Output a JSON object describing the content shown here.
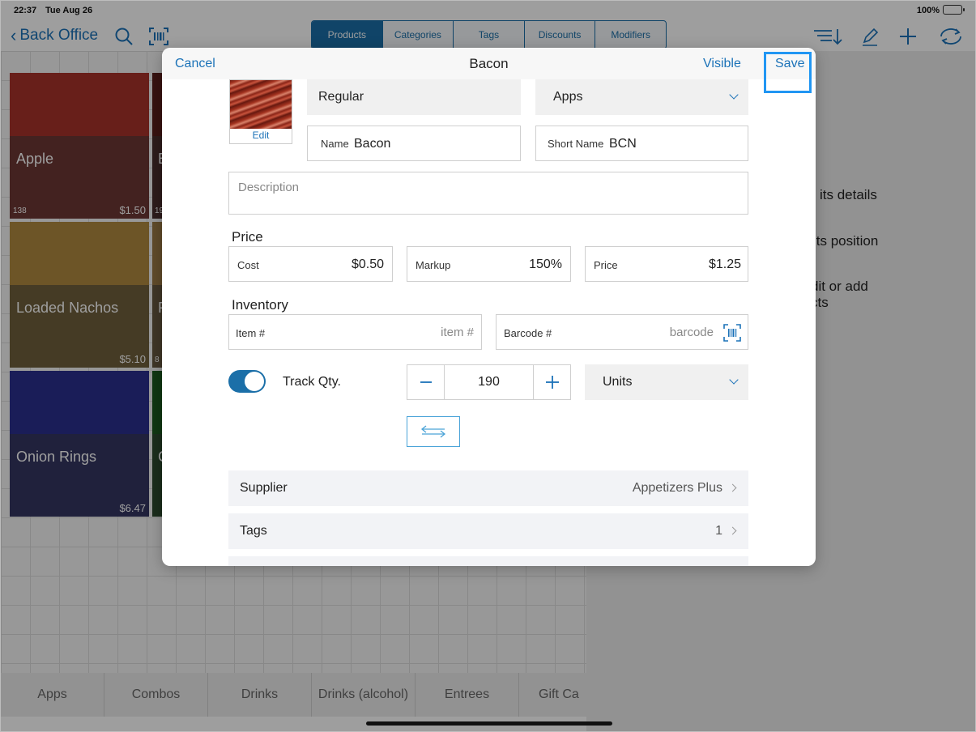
{
  "status_bar": {
    "time": "22:37",
    "date": "Tue Aug 26",
    "battery": "100%"
  },
  "nav": {
    "back_label": "Back Office",
    "tabs": [
      "Products",
      "Categories",
      "Tags",
      "Discounts",
      "Modifiers"
    ],
    "active_tab": "Products"
  },
  "tiles": [
    {
      "name": "Apple",
      "price": "$1.50",
      "count": "138",
      "color": "#a8322a"
    },
    {
      "name": "Loaded Nachos",
      "price": "$5.10",
      "count": "",
      "color": "#b0893f"
    },
    {
      "name": "Onion Rings",
      "price": "$6.47",
      "count": "",
      "color": "#2a2f8f"
    }
  ],
  "partial_tiles": [
    {
      "initial": "B",
      "count": "19",
      "color": "#5a1e1a"
    },
    {
      "initial": "F",
      "count": "8",
      "color": "#9b7a45"
    },
    {
      "initial": "C",
      "count": "",
      "color": "#1a5a1e"
    }
  ],
  "help_text": {
    "line1": "its details",
    "line2": "its position",
    "line3a": "dit or add",
    "line3b": "cts"
  },
  "bottom_tabs": [
    "Apps",
    "Combos",
    "Drinks",
    "Drinks (alcohol)",
    "Entrees",
    "Gift Ca"
  ],
  "modal": {
    "cancel": "Cancel",
    "title": "Bacon",
    "visible": "Visible",
    "save": "Save",
    "image_edit": "Edit",
    "type_value": "Regular",
    "category_value": "Apps",
    "name_label": "Name",
    "name_value": "Bacon",
    "short_name_label": "Short Name",
    "short_name_value": "BCN",
    "description_placeholder": "Description",
    "price_section": "Price",
    "cost_label": "Cost",
    "cost_value": "$0.50",
    "markup_label": "Markup",
    "markup_value": "150%",
    "price_label": "Price",
    "price_value": "$1.25",
    "inventory_section": "Inventory",
    "item_label": "Item #",
    "item_placeholder": "item #",
    "barcode_label": "Barcode #",
    "barcode_placeholder": "barcode",
    "track_qty_label": "Track Qty.",
    "track_qty_on": true,
    "quantity": "190",
    "units_value": "Units",
    "supplier_label": "Supplier",
    "supplier_value": "Appetizers Plus",
    "tags_label": "Tags",
    "tags_value": "1"
  },
  "colors": {
    "accent": "#1b72b8",
    "highlight": "#2196f3",
    "toggle": "#1b6fa8"
  }
}
